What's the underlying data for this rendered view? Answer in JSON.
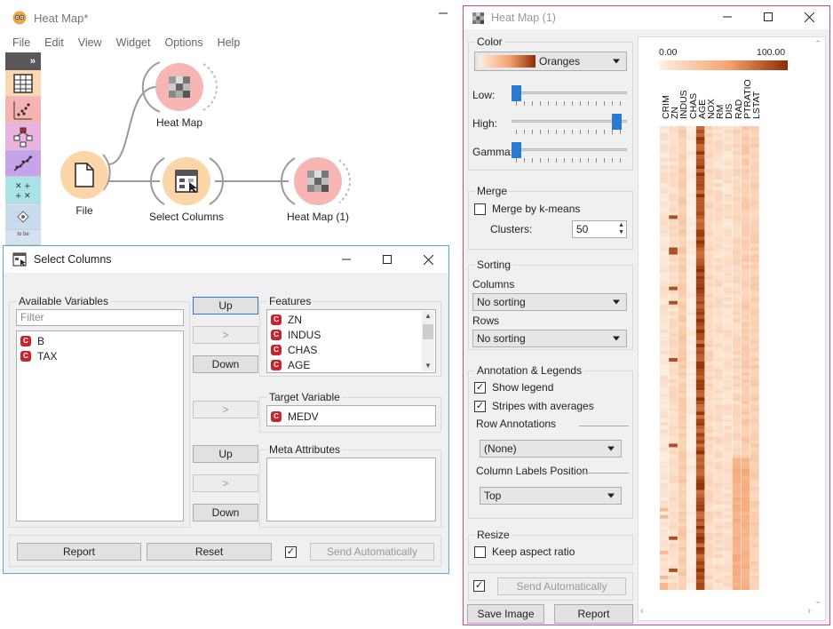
{
  "orange": {
    "title": "Heat Map*",
    "menu": [
      "File",
      "Edit",
      "View",
      "Widget",
      "Options",
      "Help"
    ],
    "toolbox_header": "»",
    "toolbox_last_label": "to be"
  },
  "nodes": {
    "file": "File",
    "select_columns": "Select Columns",
    "heat_map": "Heat Map",
    "heat_map_1": "Heat Map (1)"
  },
  "select_columns": {
    "title": "Select Columns",
    "available": {
      "title": "Available Variables",
      "filter_placeholder": "Filter",
      "items": [
        "B",
        "TAX"
      ]
    },
    "features": {
      "title": "Features",
      "items": [
        "ZN",
        "INDUS",
        "CHAS",
        "AGE"
      ]
    },
    "target": {
      "title": "Target Variable",
      "value": "MEDV"
    },
    "meta": {
      "title": "Meta Attributes"
    },
    "buttons": {
      "up": "Up",
      "move": ">",
      "down": "Down",
      "report": "Report",
      "reset": "Reset",
      "send": "Send Automatically"
    },
    "badge": "C"
  },
  "heatmap": {
    "title": "Heat Map (1)",
    "color": {
      "title": "Color",
      "palette": "Oranges",
      "low_label": "Low:",
      "high_label": "High:",
      "gamma_label": "Gamma:",
      "low": 0.0,
      "high": 0.95,
      "gamma": 0.0
    },
    "merge": {
      "title": "Merge",
      "kmeans_label": "Merge by k-means",
      "clusters_label": "Clusters:",
      "clusters": "50"
    },
    "sorting": {
      "title": "Sorting",
      "columns_label": "Columns",
      "columns_value": "No sorting",
      "rows_label": "Rows",
      "rows_value": "No sorting"
    },
    "annotation": {
      "title": "Annotation & Legends",
      "show_legend": "Show legend",
      "stripes": "Stripes with averages",
      "row_annotations_label": "Row Annotations",
      "row_annotations_value": "(None)",
      "col_labels_label": "Column Labels Position",
      "col_labels_value": "Top"
    },
    "resize": {
      "title": "Resize",
      "keep_aspect": "Keep aspect ratio"
    },
    "send_label": "Send Automatically",
    "save_image": "Save Image",
    "report": "Report",
    "legend_min": "0.00",
    "legend_max": "100.00",
    "columns": [
      "CRIM",
      "ZN",
      "INDUS",
      "CHAS",
      "AGE",
      "NOX",
      "RM",
      "DIS",
      "RAD",
      "PTRATIO",
      "LSTAT"
    ],
    "colors": {
      "low": "#fdf0e3",
      "high": "#8c2d04",
      "accent": "#2a7ad0"
    }
  }
}
